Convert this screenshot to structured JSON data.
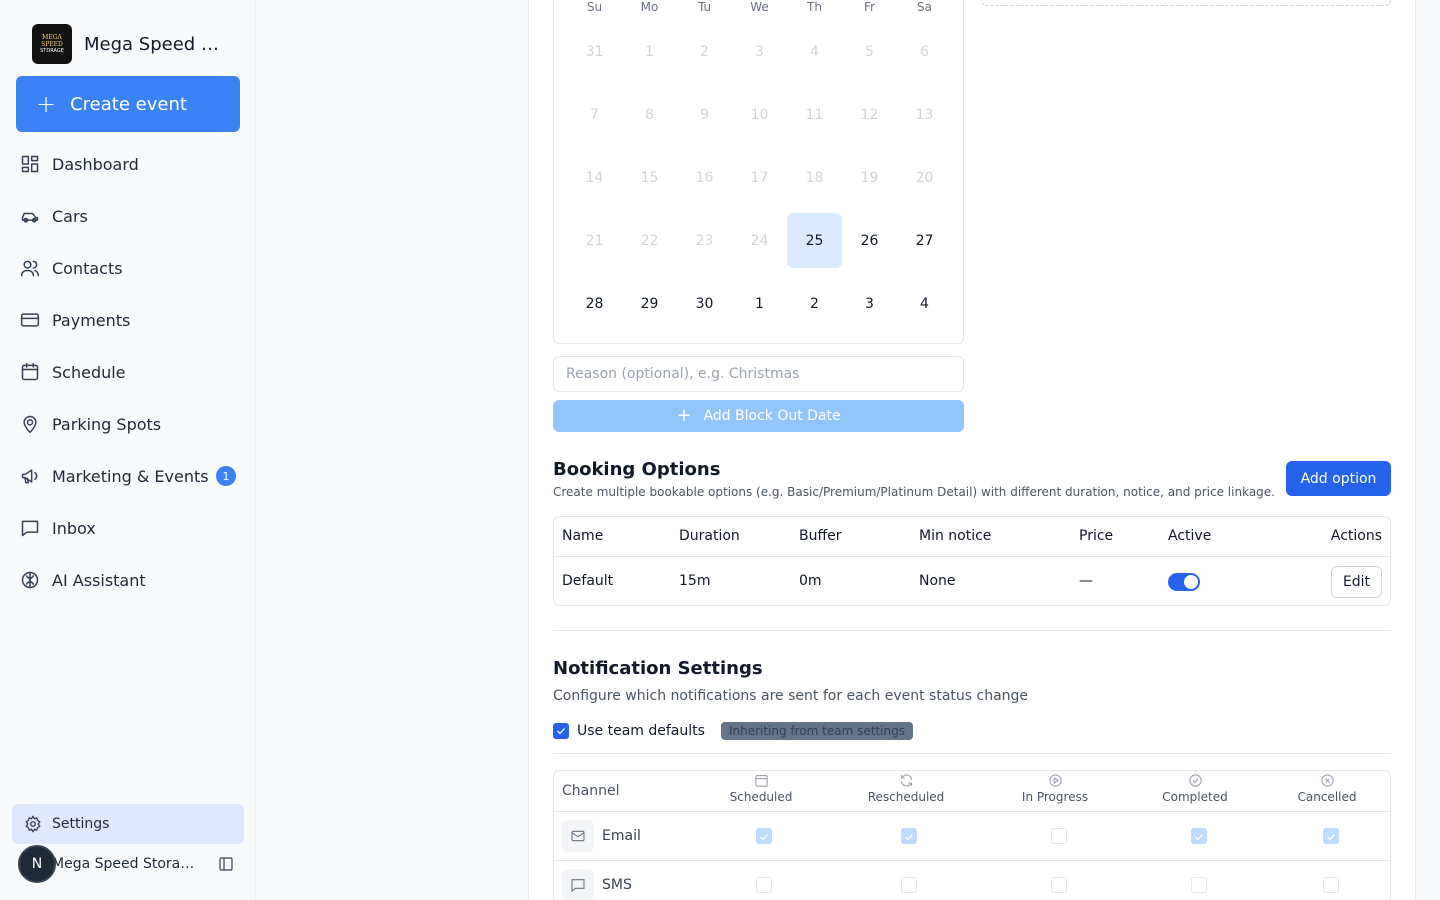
{
  "brand": {
    "name": "Mega Speed St...",
    "logo_line1": "MEGA SPEED",
    "logo_line2": "STORAGE"
  },
  "sidebar": {
    "create_label": "Create event",
    "items": [
      {
        "label": "Dashboard",
        "icon": "dashboard-icon"
      },
      {
        "label": "Cars",
        "icon": "car-icon"
      },
      {
        "label": "Contacts",
        "icon": "users-icon"
      },
      {
        "label": "Payments",
        "icon": "credit-card-icon"
      },
      {
        "label": "Schedule",
        "icon": "calendar-icon"
      },
      {
        "label": "Parking Spots",
        "icon": "map-pin-icon"
      },
      {
        "label": "Marketing & Events",
        "icon": "megaphone-icon",
        "badge": "1"
      },
      {
        "label": "Inbox",
        "icon": "message-icon"
      },
      {
        "label": "AI Assistant",
        "icon": "brain-icon"
      }
    ],
    "settings_label": "Settings",
    "user_initial": "N",
    "user_name": "Mega Speed Storag..."
  },
  "calendar": {
    "weekdays": [
      "Su",
      "Mo",
      "Tu",
      "We",
      "Th",
      "Fr",
      "Sa"
    ],
    "weeks": [
      [
        "31",
        "1",
        "2",
        "3",
        "4",
        "5",
        "6"
      ],
      [
        "7",
        "8",
        "9",
        "10",
        "11",
        "12",
        "13"
      ],
      [
        "14",
        "15",
        "16",
        "17",
        "18",
        "19",
        "20"
      ],
      [
        "21",
        "22",
        "23",
        "24",
        "25",
        "26",
        "27"
      ],
      [
        "28",
        "29",
        "30",
        "1",
        "2",
        "3",
        "4"
      ]
    ],
    "selected": "25"
  },
  "block_out": {
    "reason_placeholder": "Reason (optional), e.g. Christmas",
    "add_label": "Add Block Out Date"
  },
  "booking": {
    "title": "Booking Options",
    "subtitle": "Create multiple bookable options (e.g. Basic/Premium/Platinum Detail) with different duration, notice, and price linkage.",
    "add_label": "Add option",
    "headers": {
      "name": "Name",
      "duration": "Duration",
      "buffer": "Buffer",
      "notice": "Min notice",
      "price": "Price",
      "active": "Active",
      "actions": "Actions"
    },
    "rows": [
      {
        "name": "Default",
        "duration": "15m",
        "buffer": "0m",
        "notice": "None",
        "price": "—",
        "active": true,
        "edit_label": "Edit"
      }
    ]
  },
  "notifications": {
    "title": "Notification Settings",
    "subtitle": "Configure which notifications are sent for each event status change",
    "team_defaults_label": "Use team defaults",
    "inherit_badge": "Inheriting from team settings",
    "channel_header": "Channel",
    "columns": [
      "Scheduled",
      "Rescheduled",
      "In Progress",
      "Completed",
      "Cancelled"
    ],
    "rows": [
      {
        "channel": "Email",
        "values": [
          true,
          true,
          false,
          true,
          true
        ]
      },
      {
        "channel": "SMS",
        "values": [
          false,
          false,
          false,
          false,
          false
        ]
      }
    ]
  },
  "colors": {
    "primary": "#2563eb",
    "accent": "#3b82f6",
    "disabled": "#93c5fd"
  }
}
